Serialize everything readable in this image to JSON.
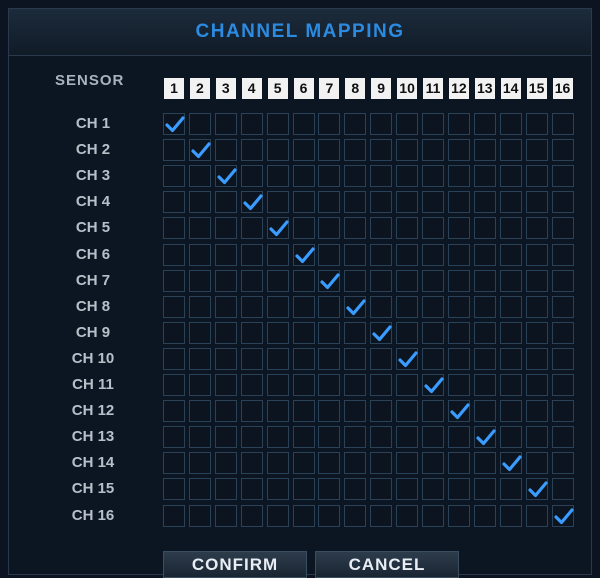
{
  "dialog": {
    "title": "CHANNEL MAPPING",
    "sensor_label": "SENSOR",
    "sensors": [
      "1",
      "2",
      "3",
      "4",
      "5",
      "6",
      "7",
      "8",
      "9",
      "10",
      "11",
      "12",
      "13",
      "14",
      "15",
      "16"
    ],
    "channels": [
      {
        "label": "CH 1",
        "checked": [
          1
        ]
      },
      {
        "label": "CH 2",
        "checked": [
          2
        ]
      },
      {
        "label": "CH 3",
        "checked": [
          3
        ]
      },
      {
        "label": "CH 4",
        "checked": [
          4
        ]
      },
      {
        "label": "CH 5",
        "checked": [
          5
        ]
      },
      {
        "label": "CH 6",
        "checked": [
          6
        ]
      },
      {
        "label": "CH 7",
        "checked": [
          7
        ]
      },
      {
        "label": "CH 8",
        "checked": [
          8
        ]
      },
      {
        "label": "CH 9",
        "checked": [
          9
        ]
      },
      {
        "label": "CH 10",
        "checked": [
          10
        ]
      },
      {
        "label": "CH 11",
        "checked": [
          11
        ]
      },
      {
        "label": "CH 12",
        "checked": [
          12
        ]
      },
      {
        "label": "CH 13",
        "checked": [
          13
        ]
      },
      {
        "label": "CH 14",
        "checked": [
          14
        ]
      },
      {
        "label": "CH 15",
        "checked": [
          15
        ]
      },
      {
        "label": "CH 16",
        "checked": [
          16
        ]
      }
    ],
    "buttons": {
      "confirm": "CONFIRM",
      "cancel": "CANCEL"
    },
    "colors": {
      "title": "#2c8be0",
      "check": "#3b9cff",
      "cell_border": "#2a4258"
    }
  }
}
